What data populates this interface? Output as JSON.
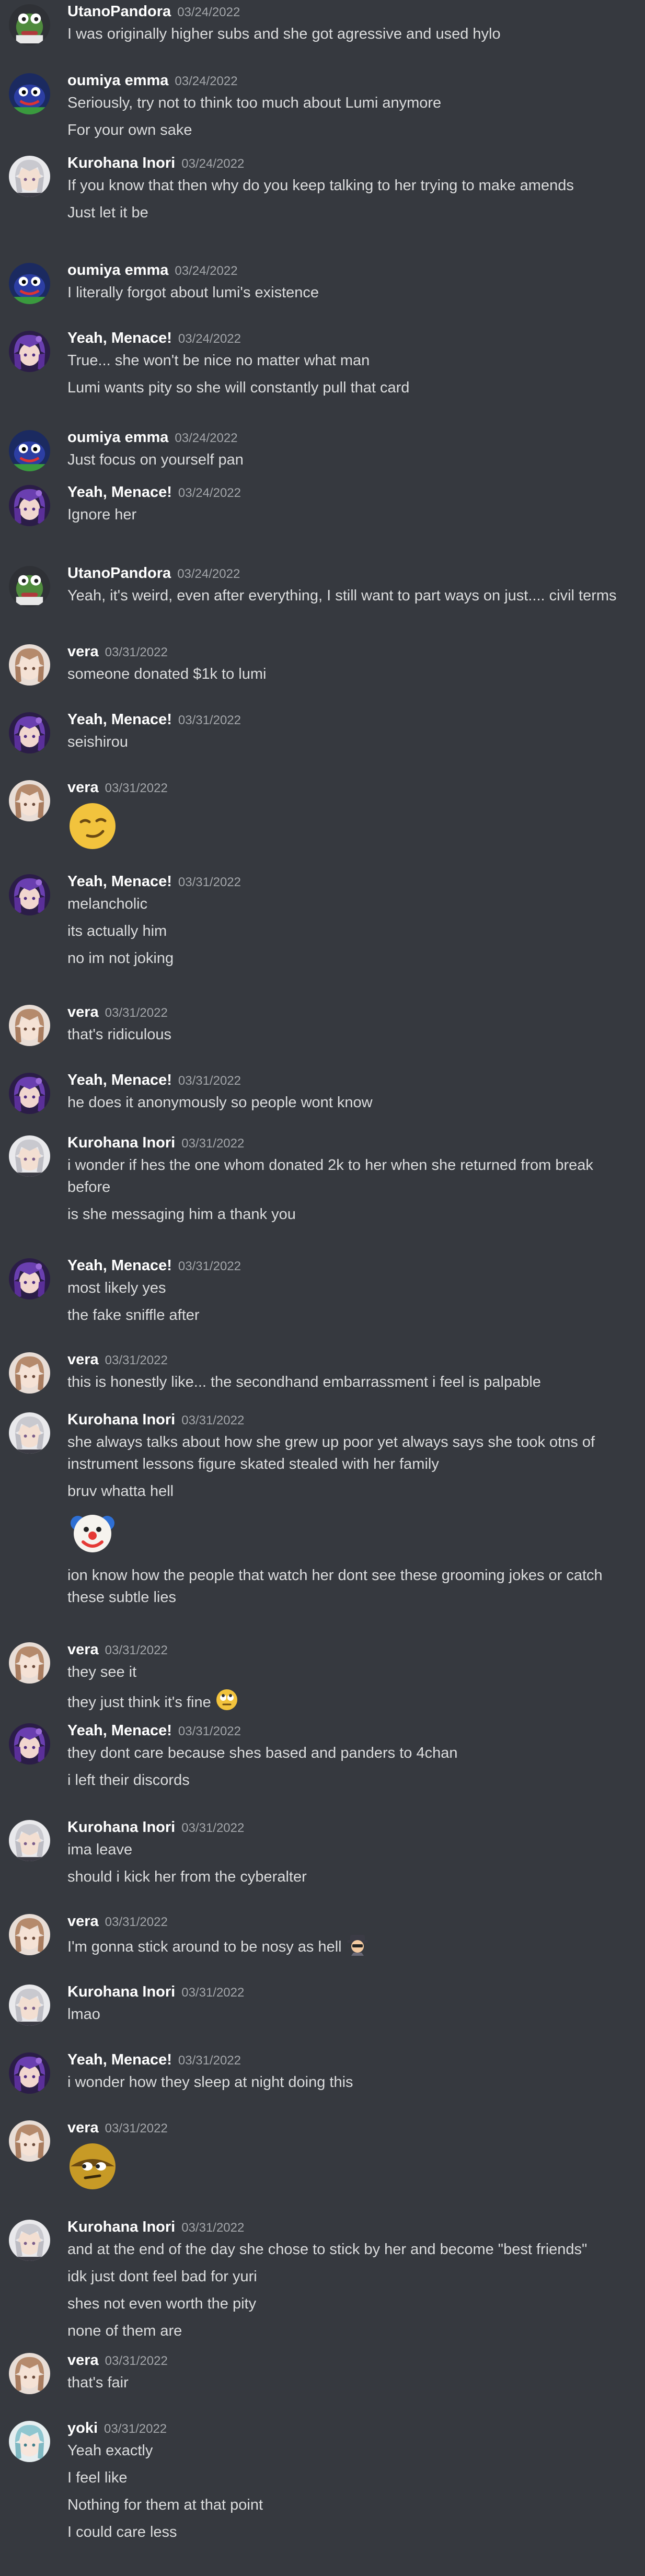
{
  "messages": [
    {
      "author": "UtanoPandora",
      "timestamp": "03/24/2022",
      "avatar": "frog-avatar-icon",
      "lines": [
        "I was originally higher subs and she got agressive and used hylo"
      ]
    },
    {
      "author": "oumiya emma",
      "timestamp": "03/24/2022",
      "avatar": "blue-creature-avatar-icon",
      "lines": [
        "Seriously, try not to think too much about Lumi anymore",
        "For your own sake"
      ]
    },
    {
      "author": "Kurohana Inori",
      "timestamp": "03/24/2022",
      "avatar": "white-hair-avatar-icon",
      "lines": [
        "If you know that then why do you keep talking to her trying  to make amends",
        "Just let it be"
      ]
    },
    {
      "author": "oumiya emma",
      "timestamp": "03/24/2022",
      "avatar": "blue-creature-avatar-icon",
      "lines": [
        "I literally forgot about lumi's existence"
      ]
    },
    {
      "author": "Yeah, Menace!",
      "timestamp": "03/24/2022",
      "avatar": "purple-hair-avatar-icon",
      "lines": [
        "True... she won't be nice no matter what man",
        "Lumi wants pity so she will constantly pull that card"
      ]
    },
    {
      "author": "oumiya emma",
      "timestamp": "03/24/2022",
      "avatar": "blue-creature-avatar-icon",
      "lines": [
        "Just focus on yourself pan"
      ]
    },
    {
      "author": "Yeah, Menace!",
      "timestamp": "03/24/2022",
      "avatar": "purple-hair-avatar-icon",
      "lines": [
        "Ignore her"
      ]
    },
    {
      "author": "UtanoPandora",
      "timestamp": "03/24/2022",
      "avatar": "frog-avatar-icon",
      "lines": [
        "Yeah, it's weird, even after everything, I still want to part ways on just.... civil terms"
      ]
    },
    {
      "author": "vera",
      "timestamp": "03/31/2022",
      "avatar": "brown-hair-avatar-icon",
      "lines": [
        "someone donated $1k to lumi"
      ]
    },
    {
      "author": "Yeah, Menace!",
      "timestamp": "03/31/2022",
      "avatar": "purple-hair-avatar-icon",
      "lines": [
        "seishirou"
      ]
    },
    {
      "author": "vera",
      "timestamp": "03/31/2022",
      "avatar": "brown-hair-avatar-icon",
      "lines": [],
      "emoji": "smirk-emoji-icon"
    },
    {
      "author": "Yeah, Menace!",
      "timestamp": "03/31/2022",
      "avatar": "purple-hair-avatar-icon",
      "lines": [
        "melancholic",
        "its actually him",
        "no im not joking"
      ]
    },
    {
      "author": "vera",
      "timestamp": "03/31/2022",
      "avatar": "brown-hair-avatar-icon",
      "lines": [
        "that's ridiculous"
      ]
    },
    {
      "author": "Yeah, Menace!",
      "timestamp": "03/31/2022",
      "avatar": "purple-hair-avatar-icon",
      "lines": [
        "he does it anonymously so people wont know"
      ]
    },
    {
      "author": "Kurohana Inori",
      "timestamp": "03/31/2022",
      "avatar": "white-hair-avatar-icon",
      "lines": [
        "i wonder if hes the one whom donated 2k to her when she returned from break before",
        "is she messaging him a thank you"
      ]
    },
    {
      "author": "Yeah, Menace!",
      "timestamp": "03/31/2022",
      "avatar": "purple-hair-avatar-icon",
      "lines": [
        "most likely yes",
        "the fake sniffle after"
      ]
    },
    {
      "author": "vera",
      "timestamp": "03/31/2022",
      "avatar": "brown-hair-avatar-icon",
      "lines": [
        "this is honestly like... the secondhand embarrassment i feel is palpable"
      ]
    },
    {
      "author": "Kurohana Inori",
      "timestamp": "03/31/2022",
      "avatar": "white-hair-avatar-icon",
      "lines": [
        "she always talks about how she grew up poor yet always says she took otns of instrument lessons figure skated stealed with her family",
        "bruv whatta hell"
      ],
      "emoji": "clown-emoji-icon",
      "after_lines": [
        "ion know how the people that watch her dont see these grooming jokes or catch these subtle lies"
      ]
    },
    {
      "author": "vera",
      "timestamp": "03/31/2022",
      "avatar": "brown-hair-avatar-icon",
      "lines": [
        "they see it",
        "they just think it's fine"
      ],
      "inline_emoji": "eye-roll-emoji-icon"
    },
    {
      "author": "Yeah, Menace!",
      "timestamp": "03/31/2022",
      "avatar": "purple-hair-avatar-icon",
      "lines": [
        "they dont care because shes based and panders to 4chan",
        "i left their discords"
      ]
    },
    {
      "author": "Kurohana Inori",
      "timestamp": "03/31/2022",
      "avatar": "white-hair-avatar-icon",
      "lines": [
        "ima leave",
        "should i kick her from the cyberalter"
      ]
    },
    {
      "author": "vera",
      "timestamp": "03/31/2022",
      "avatar": "brown-hair-avatar-icon",
      "lines": [
        "I'm gonna stick around to be nosy as hell"
      ],
      "inline_emoji": "spy-emoji-icon"
    },
    {
      "author": "Kurohana Inori",
      "timestamp": "03/31/2022",
      "avatar": "white-hair-avatar-icon",
      "lines": [
        "lmao"
      ]
    },
    {
      "author": "Yeah, Menace!",
      "timestamp": "03/31/2022",
      "avatar": "purple-hair-avatar-icon",
      "lines": [
        "i wonder how they sleep at night doing this"
      ]
    },
    {
      "author": "vera",
      "timestamp": "03/31/2022",
      "avatar": "brown-hair-avatar-icon",
      "lines": [],
      "emoji": "side-eye-emoji-icon"
    },
    {
      "author": "Kurohana Inori",
      "timestamp": "03/31/2022",
      "avatar": "white-hair-avatar-icon",
      "lines": [
        "and at the end of the day she chose to stick by her and become \"best friends\"",
        "idk just dont feel bad for yuri",
        "shes not even worth the pity",
        "none of them are"
      ]
    },
    {
      "author": "vera",
      "timestamp": "03/31/2022",
      "avatar": "brown-hair-avatar-icon",
      "lines": [
        "that's fair"
      ]
    },
    {
      "author": "yoki",
      "timestamp": "03/31/2022",
      "avatar": "teal-hair-avatar-icon",
      "lines": [
        "Yeah exactly",
        "I feel like",
        "Nothing for them at that point",
        "I could care less"
      ]
    }
  ]
}
